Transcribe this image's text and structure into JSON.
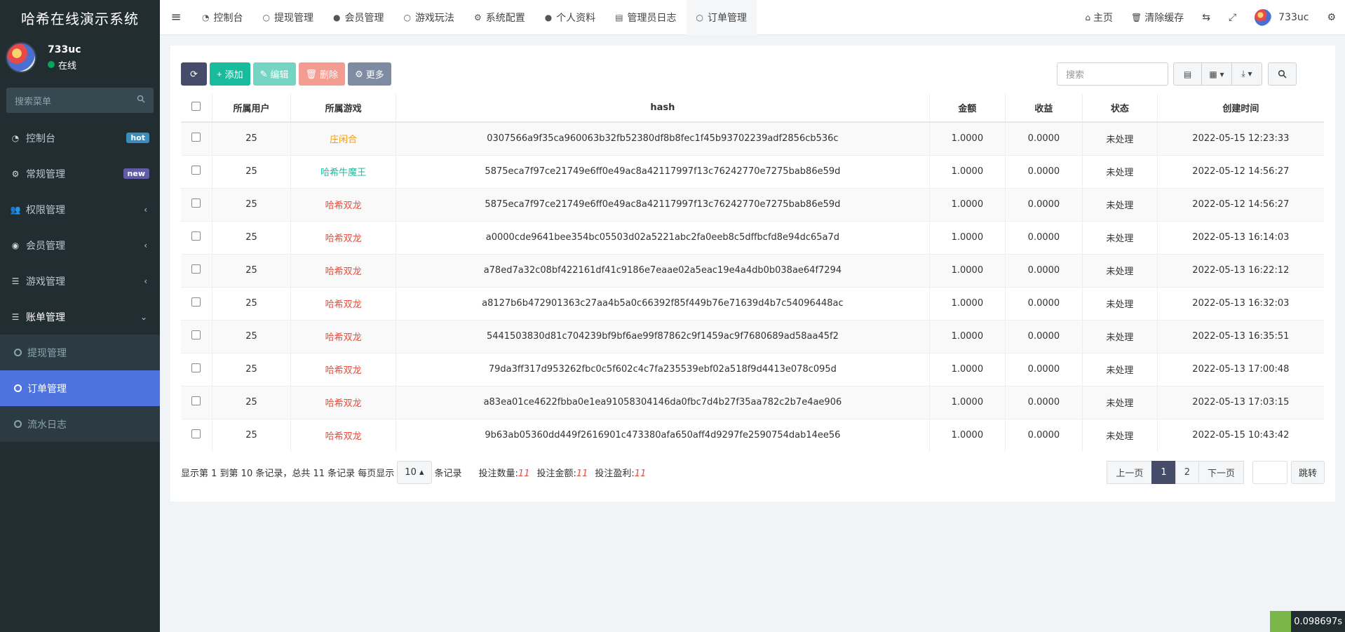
{
  "brand": {
    "title": "哈希在线演示系统"
  },
  "user": {
    "name": "733uc",
    "status": "在线"
  },
  "side_search": {
    "placeholder": "搜索菜单"
  },
  "sidebar": {
    "items": [
      {
        "label": "控制台",
        "icon": "dashboard-icon",
        "badge": "hot"
      },
      {
        "label": "常规管理",
        "icon": "cogs-icon",
        "badge": "new"
      },
      {
        "label": "权限管理",
        "icon": "group-icon"
      },
      {
        "label": "会员管理",
        "icon": "user-circle-icon"
      },
      {
        "label": "游戏管理",
        "icon": "list-icon"
      },
      {
        "label": "账单管理",
        "icon": "list-icon"
      }
    ],
    "sub_items": [
      {
        "label": "提现管理"
      },
      {
        "label": "订单管理"
      },
      {
        "label": "流水日志"
      }
    ]
  },
  "topnav": {
    "tabs": [
      {
        "label": "控制台",
        "icon": "dashboard-icon"
      },
      {
        "label": "提现管理",
        "icon": "circle-icon"
      },
      {
        "label": "会员管理",
        "icon": "user-icon"
      },
      {
        "label": "游戏玩法",
        "icon": "circle-icon"
      },
      {
        "label": "系统配置",
        "icon": "gear-icon"
      },
      {
        "label": "个人资料",
        "icon": "user-icon"
      },
      {
        "label": "管理员日志",
        "icon": "list-alt-icon"
      },
      {
        "label": "订单管理",
        "icon": "circle-icon"
      }
    ],
    "home": "主页",
    "clear_cache": "清除缓存",
    "username": "733uc"
  },
  "toolbar": {
    "add": "添加",
    "edit": "编辑",
    "delete": "删除",
    "more": "更多",
    "search_placeholder": "搜索"
  },
  "table": {
    "headers": [
      "所属用户",
      "所属游戏",
      "hash",
      "金额",
      "收益",
      "状态",
      "创建时间"
    ],
    "rows": [
      {
        "user": "25",
        "game": "庄闲合",
        "game_color": "#f39c12",
        "hash": "0307566a9f35ca960063b32fb52380df8b8fec1f45b93702239adf2856cb536c",
        "amount": "1.0000",
        "profit": "0.0000",
        "status": "未处理",
        "time": "2022-05-15 12:23:33"
      },
      {
        "user": "25",
        "game": "哈希牛魔王",
        "game_color": "#18bc9c",
        "hash": "5875eca7f97ce21749e6ff0e49ac8a42117997f13c76242770e7275bab86e59d",
        "amount": "1.0000",
        "profit": "0.0000",
        "status": "未处理",
        "time": "2022-05-12 14:56:27"
      },
      {
        "user": "25",
        "game": "哈希双龙",
        "game_color": "#e74c3c",
        "hash": "5875eca7f97ce21749e6ff0e49ac8a42117997f13c76242770e7275bab86e59d",
        "amount": "1.0000",
        "profit": "0.0000",
        "status": "未处理",
        "time": "2022-05-12 14:56:27"
      },
      {
        "user": "25",
        "game": "哈希双龙",
        "game_color": "#e74c3c",
        "hash": "a0000cde9641bee354bc05503d02a5221abc2fa0eeb8c5dffbcfd8e94dc65a7d",
        "amount": "1.0000",
        "profit": "0.0000",
        "status": "未处理",
        "time": "2022-05-13 16:14:03"
      },
      {
        "user": "25",
        "game": "哈希双龙",
        "game_color": "#e74c3c",
        "hash": "a78ed7a32c08bf422161df41c9186e7eaae02a5eac19e4a4db0b038ae64f7294",
        "amount": "1.0000",
        "profit": "0.0000",
        "status": "未处理",
        "time": "2022-05-13 16:22:12"
      },
      {
        "user": "25",
        "game": "哈希双龙",
        "game_color": "#e74c3c",
        "hash": "a8127b6b472901363c27aa4b5a0c66392f85f449b76e71639d4b7c54096448ac",
        "amount": "1.0000",
        "profit": "0.0000",
        "status": "未处理",
        "time": "2022-05-13 16:32:03"
      },
      {
        "user": "25",
        "game": "哈希双龙",
        "game_color": "#e74c3c",
        "hash": "5441503830d81c704239bf9bf6ae99f87862c9f1459ac9f7680689ad58aa45f2",
        "amount": "1.0000",
        "profit": "0.0000",
        "status": "未处理",
        "time": "2022-05-13 16:35:51"
      },
      {
        "user": "25",
        "game": "哈希双龙",
        "game_color": "#e74c3c",
        "hash": "79da3ff317d953262fbc0c5f602c4c7fa235539ebf02a518f9d4413e078c095d",
        "amount": "1.0000",
        "profit": "0.0000",
        "status": "未处理",
        "time": "2022-05-13 17:00:48"
      },
      {
        "user": "25",
        "game": "哈希双龙",
        "game_color": "#e74c3c",
        "hash": "a83ea01ce4622fbba0e1ea91058304146da0fbc7d4b27f35aa782c2b7e4ae906",
        "amount": "1.0000",
        "profit": "0.0000",
        "status": "未处理",
        "time": "2022-05-13 17:03:15"
      },
      {
        "user": "25",
        "game": "哈希双龙",
        "game_color": "#e74c3c",
        "hash": "9b63ab05360dd449f2616901c473380afa650aff4d9297fe2590754dab14ee56",
        "amount": "1.0000",
        "profit": "0.0000",
        "status": "未处理",
        "time": "2022-05-15 10:43:42"
      }
    ]
  },
  "pagination": {
    "info_prefix": "显示第 1 到第 10 条记录，总共 11 条记录 每页显示",
    "page_size": "10",
    "info_suffix": "条记录",
    "stat_count_label": "投注数量:",
    "stat_count": "11",
    "stat_amount_label": "投注金额:",
    "stat_amount": "11",
    "stat_profit_label": "投注盈利:",
    "stat_profit": "11",
    "prev": "上一页",
    "pages": [
      "1",
      "2"
    ],
    "next": "下一页",
    "go": "跳转"
  },
  "perf": {
    "time": "0.098697s"
  },
  "colors": {
    "sidebar_bg": "#222d32",
    "active_blue": "#4e73df",
    "success": "#18bc9c",
    "danger": "#e74c3c"
  }
}
